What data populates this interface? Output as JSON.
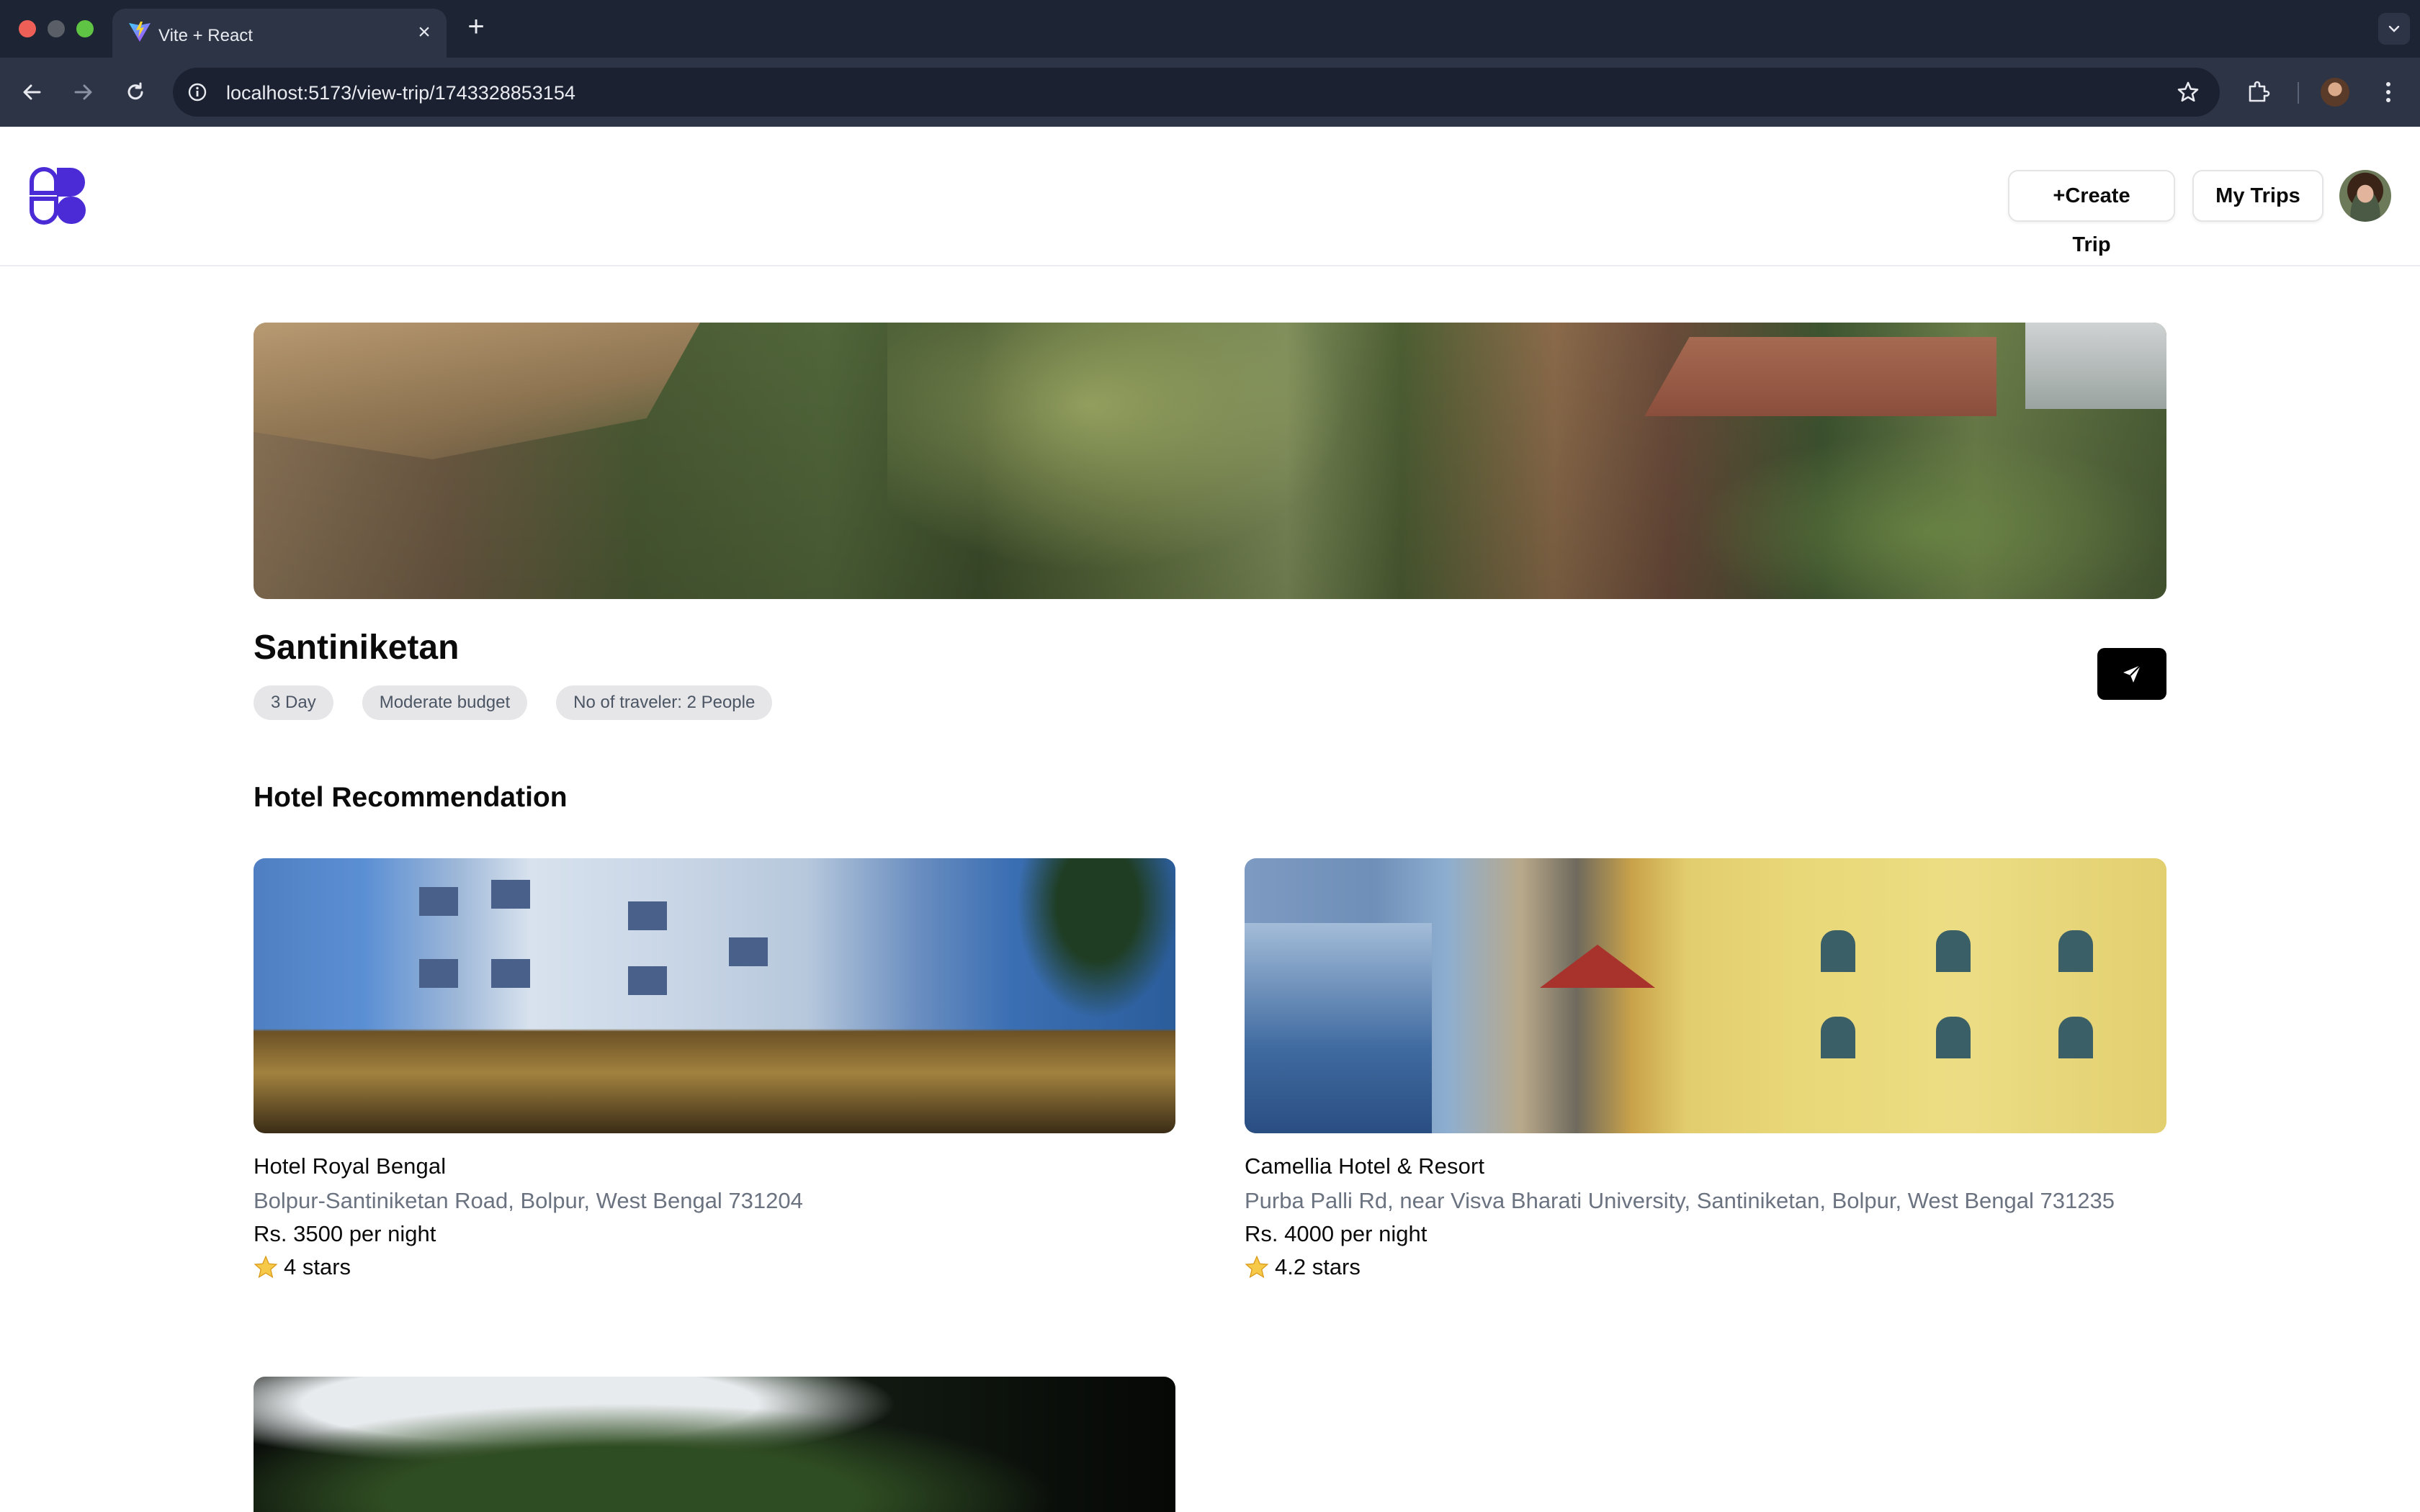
{
  "browser": {
    "tab_title": "Vite + React",
    "url": "localhost:5173/view-trip/1743328853154",
    "new_tab_label": "+",
    "close_tab_label": "×"
  },
  "header": {
    "create_trip_label": "+Create Trip",
    "my_trips_label": "My Trips"
  },
  "trip": {
    "title": "Santiniketan",
    "chips": [
      "3 Day",
      "Moderate budget",
      "No of traveler: 2 People"
    ]
  },
  "hotels_section": {
    "title": "Hotel Recommendation",
    "items": [
      {
        "name": "Hotel Royal Bengal",
        "address": "Bolpur-Santiniketan Road, Bolpur, West Bengal 731204",
        "price": "Rs. 3500 per night",
        "rating": "4 stars"
      },
      {
        "name": "Camellia Hotel & Resort",
        "address": "Purba Palli Rd, near Visva Bharati University, Santiniketan, Bolpur, West Bengal 731235",
        "price": "Rs. 4000 per night",
        "rating": "4.2 stars"
      }
    ]
  },
  "colors": {
    "browser_tabbar": "#1d2434",
    "browser_toolbar": "#2c3446",
    "brand_purple": "#4a2bd6",
    "chip_bg": "#e6e6e9",
    "share_button": "#000000"
  },
  "icons": {
    "back": "arrow-left-icon",
    "forward": "arrow-right-icon",
    "reload": "reload-icon",
    "site_info": "info-icon",
    "bookmark": "star-outline-icon",
    "extensions": "puzzle-icon",
    "menu": "kebab-icon",
    "share": "send-icon",
    "rating": "star-icon"
  }
}
